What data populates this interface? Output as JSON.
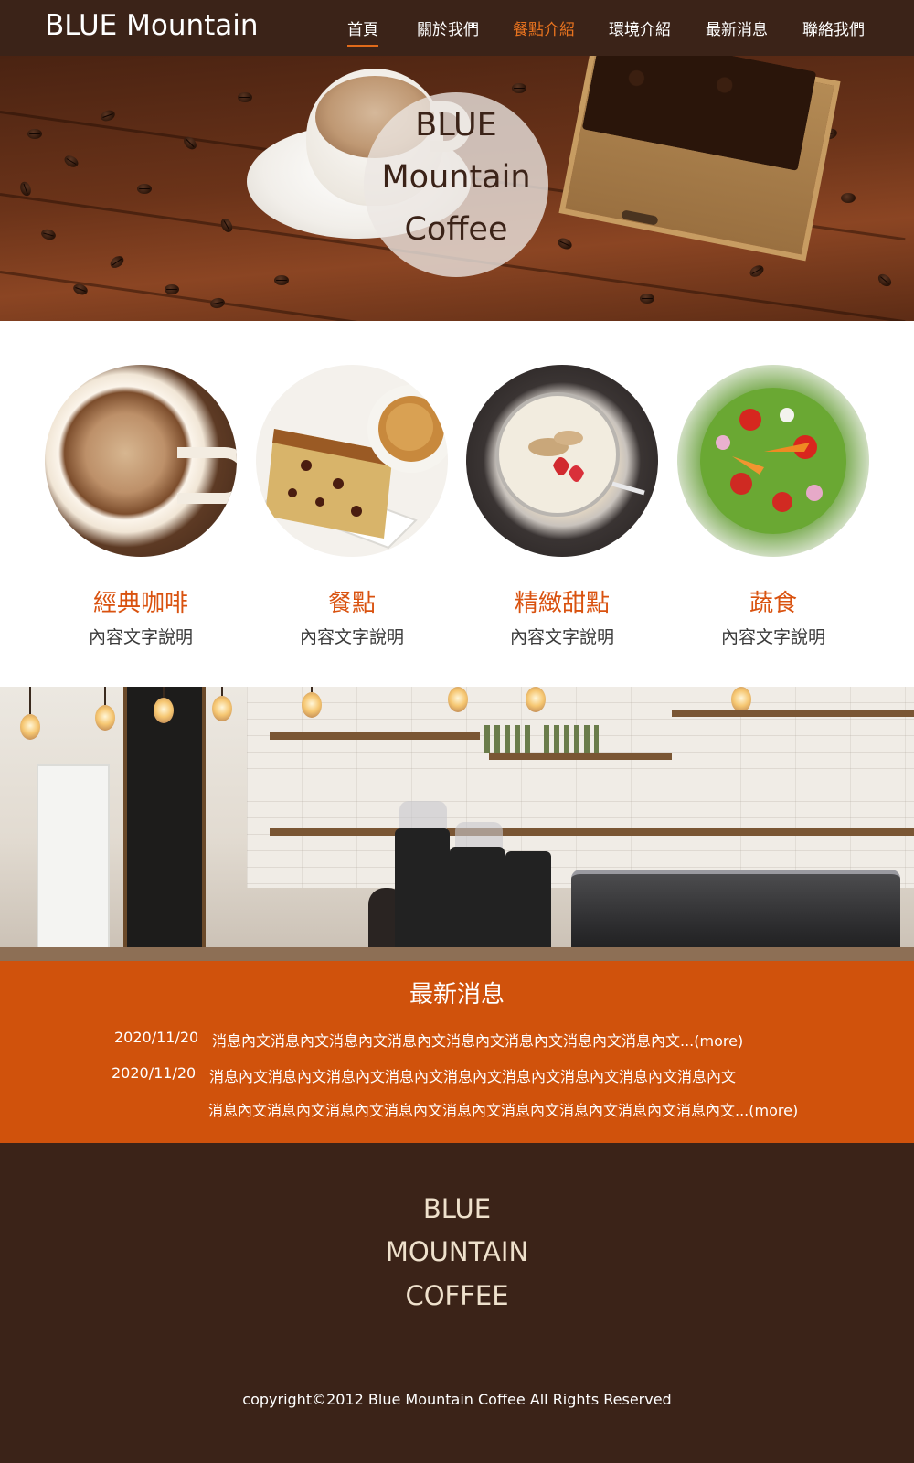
{
  "brand": "BLUE Mountain",
  "nav": [
    {
      "label": "首頁"
    },
    {
      "label": "關於我們"
    },
    {
      "label": "餐點介紹"
    },
    {
      "label": "環境介紹"
    },
    {
      "label": "最新消息"
    },
    {
      "label": "聯絡我們"
    }
  ],
  "hero": {
    "lines": [
      "BLUE",
      "Mountain",
      "Coffee"
    ]
  },
  "services": [
    {
      "title": "經典咖啡",
      "desc": "內容文字說明",
      "icon": "coffee-cup-photo"
    },
    {
      "title": "餐點",
      "desc": "內容文字說明",
      "icon": "cake-photo"
    },
    {
      "title": "精緻甜點",
      "desc": "內容文字說明",
      "icon": "yogurt-bowl-photo"
    },
    {
      "title": "蔬食",
      "desc": "內容文字說明",
      "icon": "salad-photo"
    }
  ],
  "news": {
    "title": "最新消息",
    "items": [
      {
        "date": "2020/11/20",
        "lines": [
          "消息內文消息內文消息內文消息內文消息內文消息內文消息內文消息內文..."
        ],
        "more": "(more)"
      },
      {
        "date": "2020/11/20",
        "lines": [
          "消息內文消息內文消息內文消息內文消息內文消息內文消息內文消息內文消息內文",
          "消息內文消息內文消息內文消息內文消息內文消息內文消息內文消息內文消息內文..."
        ],
        "more": "(more)"
      }
    ]
  },
  "footer": {
    "lines": [
      "BLUE",
      "MOUNTAIN",
      "COFFEE"
    ],
    "copyright": "copyright©2012 Blue Mountain Coffee  All Rights Reserved"
  },
  "colors": {
    "header_bg": "#3b2318",
    "accent": "#d9520f",
    "news_bg": "#d0520c",
    "footer_text": "#efe1cc"
  }
}
